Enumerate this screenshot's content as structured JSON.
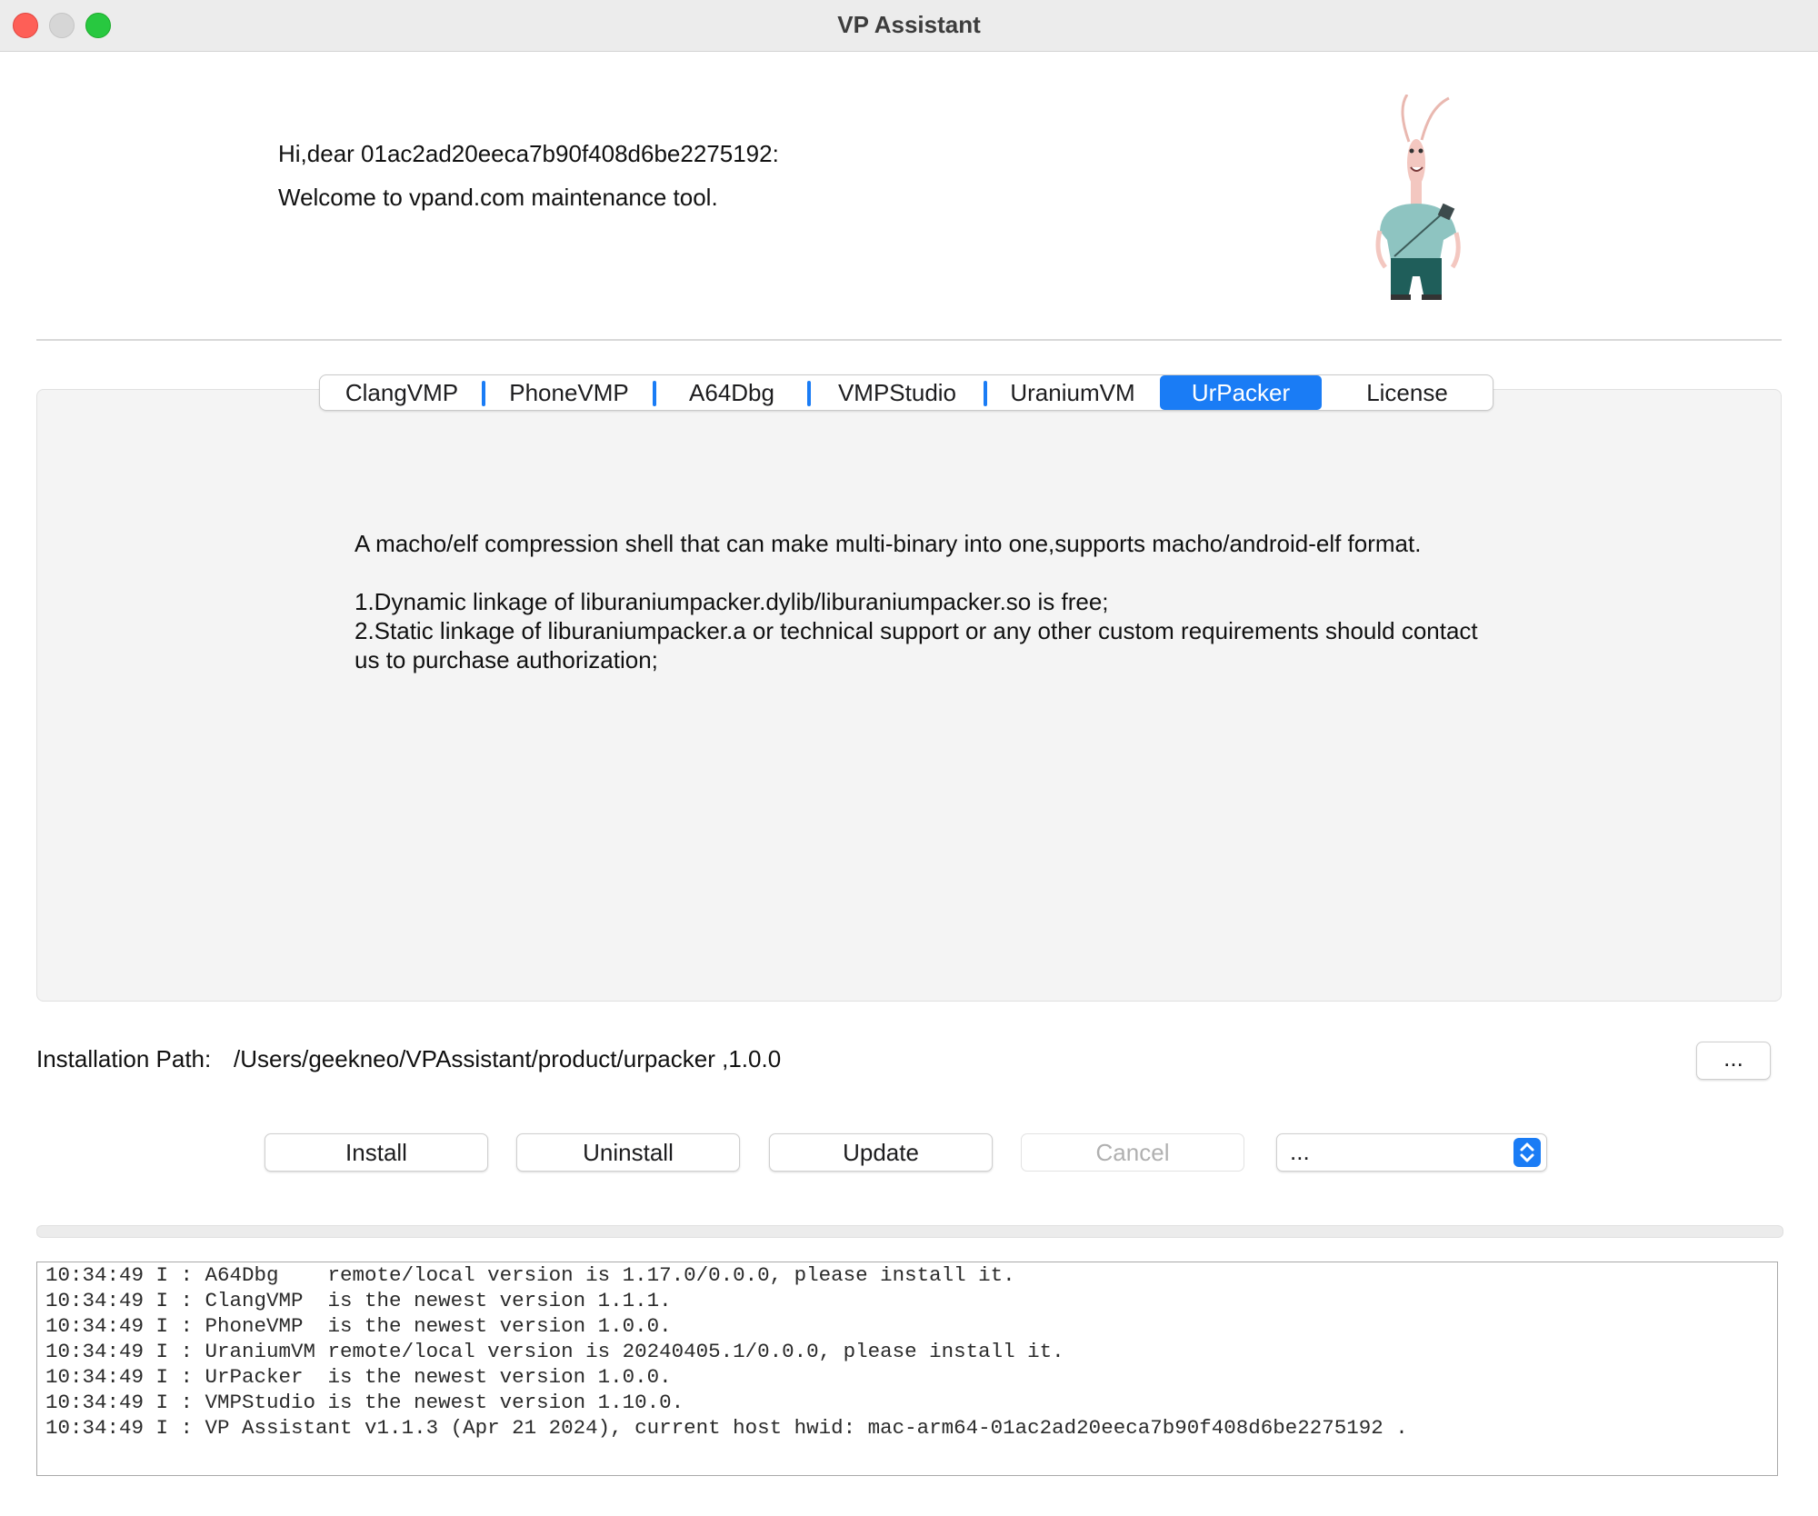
{
  "window": {
    "title": "VP Assistant"
  },
  "header": {
    "greeting": "Hi,dear 01ac2ad20eeca7b90f408d6be2275192:",
    "welcome": "Welcome to vpand.com maintenance tool."
  },
  "tabs": [
    {
      "label": "ClangVMP",
      "selected": false
    },
    {
      "label": "PhoneVMP",
      "selected": false
    },
    {
      "label": "A64Dbg",
      "selected": false
    },
    {
      "label": "VMPStudio",
      "selected": false
    },
    {
      "label": "UraniumVM",
      "selected": false
    },
    {
      "label": "UrPacker",
      "selected": true
    },
    {
      "label": "License",
      "selected": false
    }
  ],
  "description": {
    "line1": "A macho/elf compression shell that can make multi-binary into one,supports macho/android-elf format.",
    "item1": "1.Dynamic linkage of liburaniumpacker.dylib/liburaniumpacker.so is free;",
    "item2": "2.Static linkage of liburaniumpacker.a or technical support or any other custom requirements should contact us to purchase authorization;"
  },
  "installation": {
    "label": "Installation Path:",
    "path": "/Users/geekneo/VPAssistant/product/urpacker ,1.0.0",
    "browse_label": "..."
  },
  "actions": {
    "install": "Install",
    "uninstall": "Uninstall",
    "update": "Update",
    "cancel": "Cancel",
    "select_value": "..."
  },
  "progress": {
    "fraction": 0
  },
  "log": [
    "10:34:49 I : A64Dbg    remote/local version is 1.17.0/0.0.0, please install it.",
    "10:34:49 I : ClangVMP  is the newest version 1.1.1.",
    "10:34:49 I : PhoneVMP  is the newest version 1.0.0.",
    "10:34:49 I : UraniumVM remote/local version is 20240405.1/0.0.0, please install it.",
    "10:34:49 I : UrPacker  is the newest version 1.0.0.",
    "10:34:49 I : VMPStudio is the newest version 1.10.0.",
    "10:34:49 I : VP Assistant v1.1.3 (Apr 21 2024), current host hwid: mac-arm64-01ac2ad20eeca7b90f408d6be2275192 ."
  ],
  "colors": {
    "accent": "#1a7cf5",
    "close": "#fe5f57",
    "maximize": "#28c840"
  }
}
